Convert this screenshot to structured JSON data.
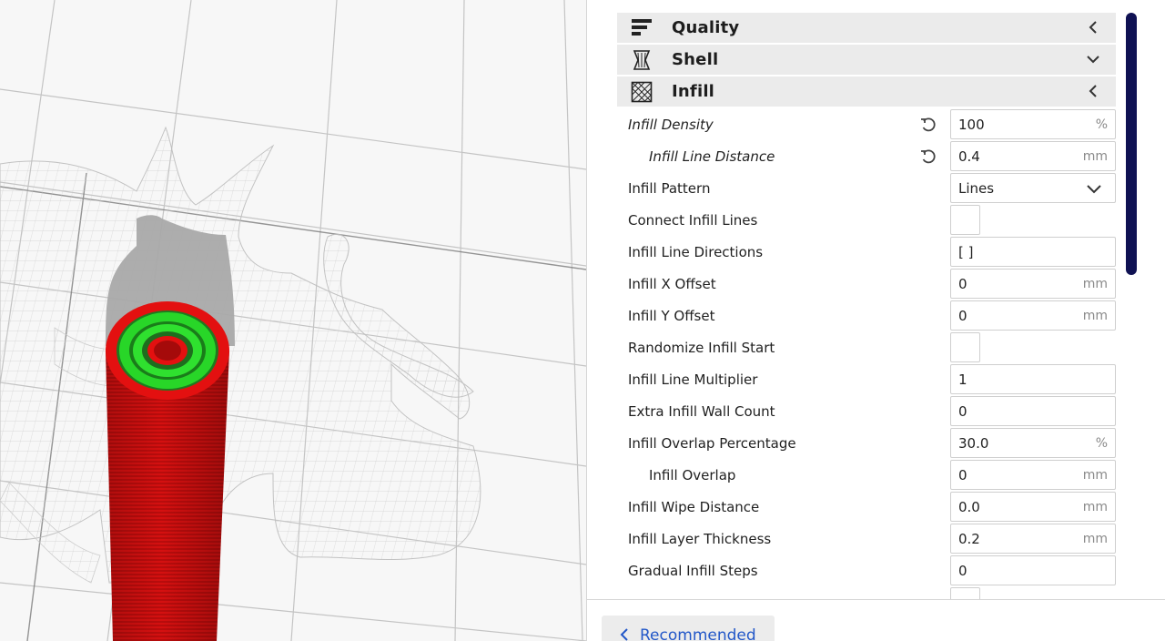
{
  "settings": {
    "categories": {
      "quality": {
        "label": "Quality",
        "icon": "quality-icon",
        "state": "collapsed"
      },
      "shell": {
        "label": "Shell",
        "icon": "shell-icon",
        "state": "expanded-chevron-down"
      },
      "infill": {
        "label": "Infill",
        "icon": "infill-icon",
        "state": "collapsed"
      }
    },
    "rows": [
      {
        "label": "Infill Density",
        "value": "100",
        "unit": "%",
        "italic": true,
        "reset": true
      },
      {
        "label": "Infill Line Distance",
        "value": "0.4",
        "unit": "mm",
        "italic": true,
        "indent": true,
        "reset": true
      },
      {
        "label": "Infill Pattern",
        "value": "Lines",
        "type": "dropdown"
      },
      {
        "label": "Connect Infill Lines",
        "type": "checkbox",
        "checked": false
      },
      {
        "label": "Infill Line Directions",
        "value": "[ ]"
      },
      {
        "label": "Infill X Offset",
        "value": "0",
        "unit": "mm"
      },
      {
        "label": "Infill Y Offset",
        "value": "0",
        "unit": "mm"
      },
      {
        "label": "Randomize Infill Start",
        "type": "checkbox",
        "checked": false
      },
      {
        "label": "Infill Line Multiplier",
        "value": "1"
      },
      {
        "label": "Extra Infill Wall Count",
        "value": "0"
      },
      {
        "label": "Infill Overlap Percentage",
        "value": "30.0",
        "unit": "%"
      },
      {
        "label": "Infill Overlap",
        "value": "0",
        "unit": "mm",
        "indent": true
      },
      {
        "label": "Infill Wipe Distance",
        "value": "0.0",
        "unit": "mm"
      },
      {
        "label": "Infill Layer Thickness",
        "value": "0.2",
        "unit": "mm"
      },
      {
        "label": "Gradual Infill Steps",
        "value": "0"
      }
    ]
  },
  "footer": {
    "recommended_label": "Recommended"
  },
  "colors": {
    "model_wall": "#e31010",
    "model_top_ring": "#28d628",
    "scrollbar": "#0f1153",
    "accent_link": "#2257c8"
  }
}
